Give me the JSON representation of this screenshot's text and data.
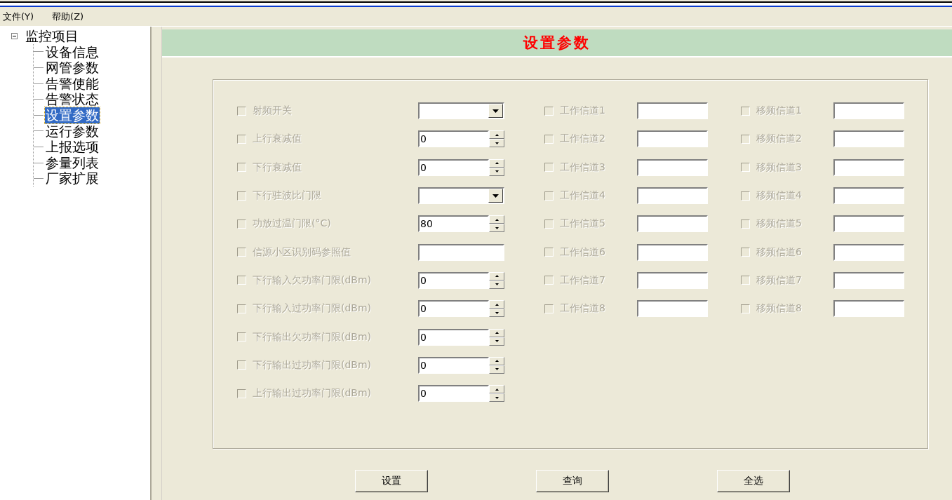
{
  "menu": [
    {
      "label": "文件(Y)"
    },
    {
      "label": "帮助(Z)"
    }
  ],
  "tree": {
    "label": "监控项目",
    "expanded": true,
    "children": [
      {
        "label": "设备信息",
        "selected": false
      },
      {
        "label": "网管参数",
        "selected": false
      },
      {
        "label": "告警使能",
        "selected": false
      },
      {
        "label": "告警状态",
        "selected": false
      },
      {
        "label": "设置参数",
        "selected": true
      },
      {
        "label": "运行参数",
        "selected": false
      },
      {
        "label": "上报选项",
        "selected": false
      },
      {
        "label": "参量列表",
        "selected": false
      },
      {
        "label": "厂家扩展",
        "selected": false
      }
    ]
  },
  "panel_title": "设置参数",
  "parameters": [
    {
      "kind": "dropdown",
      "label": "射频开关",
      "checked": false,
      "disabled": true
    },
    {
      "kind": "spin",
      "label": "上行衰减值",
      "value": "0",
      "checked": false,
      "disabled": true
    },
    {
      "kind": "spin",
      "label": "下行衰减值",
      "value": "0",
      "checked": false,
      "disabled": true
    },
    {
      "kind": "dropdown",
      "label": "下行驻波比门限",
      "checked": false,
      "disabled": true
    },
    {
      "kind": "spin",
      "label": "功放过温门限(°C)",
      "value": "80",
      "checked": false,
      "disabled": true
    },
    {
      "kind": "text",
      "label": "信源小区识别码参照值",
      "checked": false,
      "disabled": true
    },
    {
      "kind": "spin",
      "label": "下行输入欠功率门限(dBm)",
      "value": "0",
      "checked": false,
      "disabled": true
    },
    {
      "kind": "spin",
      "label": "下行输入过功率门限(dBm)",
      "value": "0",
      "checked": false,
      "disabled": true
    },
    {
      "kind": "spin",
      "label": "下行输出欠功率门限(dBm)",
      "value": "0",
      "checked": false,
      "disabled": true
    },
    {
      "kind": "spin",
      "label": "下行输出过功率门限(dBm)",
      "value": "0",
      "checked": false,
      "disabled": true
    },
    {
      "kind": "spin",
      "label": "上行输出过功率门限(dBm)",
      "value": "0",
      "checked": false,
      "disabled": true
    }
  ],
  "work_channels": [
    {
      "label": "工作信道1",
      "checked": false,
      "disabled": true
    },
    {
      "label": "工作信道2",
      "checked": false,
      "disabled": true
    },
    {
      "label": "工作信道3",
      "checked": false,
      "disabled": true
    },
    {
      "label": "工作信道4",
      "checked": false,
      "disabled": true
    },
    {
      "label": "工作信道5",
      "checked": false,
      "disabled": true
    },
    {
      "label": "工作信道6",
      "checked": false,
      "disabled": true
    },
    {
      "label": "工作信道7",
      "checked": false,
      "disabled": true
    },
    {
      "label": "工作信道8",
      "checked": false,
      "disabled": true
    }
  ],
  "shift_channels": [
    {
      "label": "移频信道1",
      "checked": false,
      "disabled": true
    },
    {
      "label": "移频信道2",
      "checked": false,
      "disabled": true
    },
    {
      "label": "移频信道3",
      "checked": false,
      "disabled": true
    },
    {
      "label": "移频信道4",
      "checked": false,
      "disabled": true
    },
    {
      "label": "移频信道5",
      "checked": false,
      "disabled": true
    },
    {
      "label": "移频信道6",
      "checked": false,
      "disabled": true
    },
    {
      "label": "移频信道7",
      "checked": false,
      "disabled": true
    },
    {
      "label": "移频信道8",
      "checked": false,
      "disabled": true
    }
  ],
  "buttons": [
    {
      "label": "设置"
    },
    {
      "label": "查询"
    },
    {
      "label": "全选"
    }
  ]
}
